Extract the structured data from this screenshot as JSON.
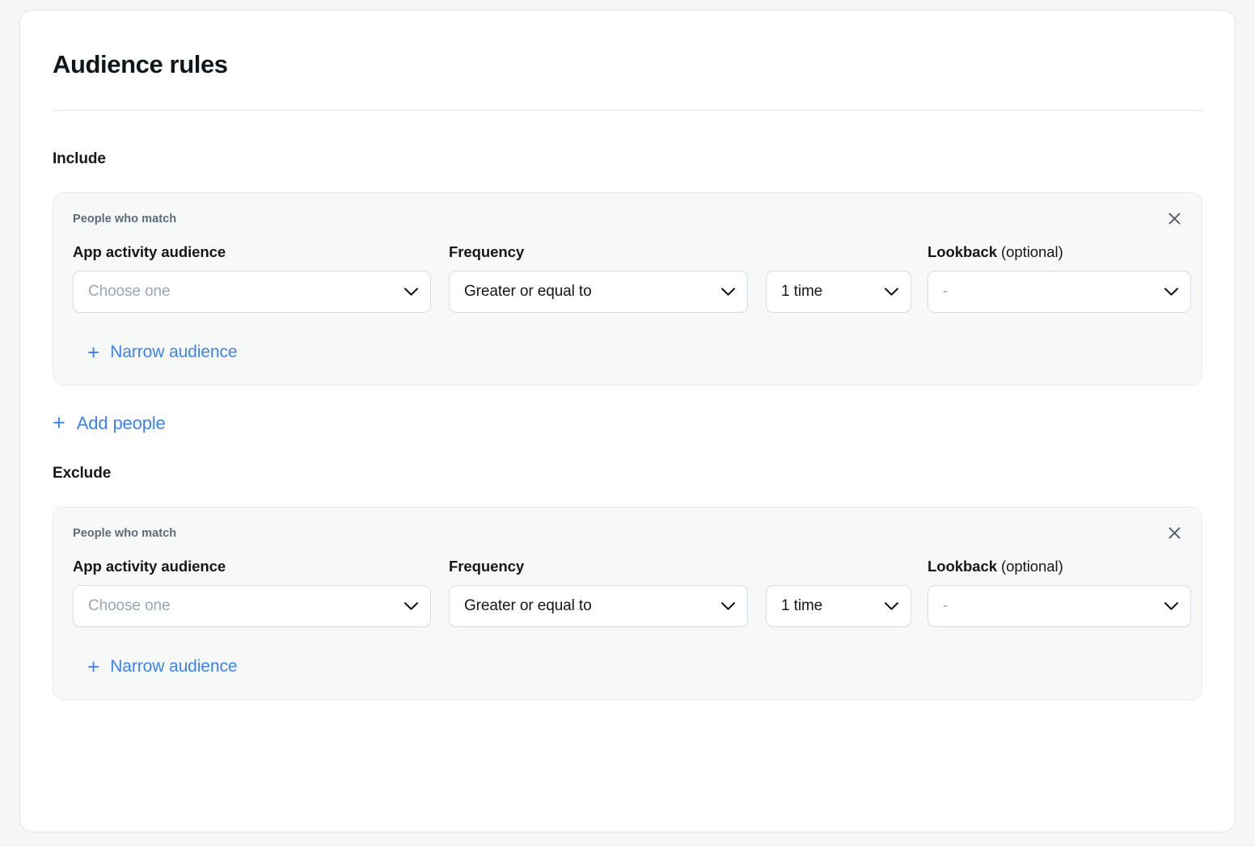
{
  "panel": {
    "title": "Audience rules"
  },
  "sections": [
    {
      "key": "include",
      "title": "Include",
      "card": {
        "eyebrow": "People who match",
        "close_icon": "close-icon",
        "fields": {
          "audience": {
            "label": "App activity audience",
            "value": "Choose one",
            "is_placeholder": true
          },
          "frequency": {
            "label": "Frequency",
            "value": "Greater or equal to",
            "is_placeholder": false
          },
          "count": {
            "label": "",
            "value": "1 time",
            "is_placeholder": false
          },
          "lookback": {
            "label": "Lookback",
            "label_optional": " (optional)",
            "value": "-",
            "is_placeholder": true
          }
        },
        "narrow_link": {
          "icon": "plus-icon",
          "label": "Narrow audience"
        }
      },
      "add_link": {
        "icon": "plus-icon",
        "label": "Add people"
      }
    },
    {
      "key": "exclude",
      "title": "Exclude",
      "card": {
        "eyebrow": "People who match",
        "close_icon": "close-icon",
        "fields": {
          "audience": {
            "label": "App activity audience",
            "value": "Choose one",
            "is_placeholder": true
          },
          "frequency": {
            "label": "Frequency",
            "value": "Greater or equal to",
            "is_placeholder": false
          },
          "count": {
            "label": "",
            "value": "1 time",
            "is_placeholder": false
          },
          "lookback": {
            "label": "Lookback",
            "label_optional": " (optional)",
            "value": "-",
            "is_placeholder": true
          }
        },
        "narrow_link": {
          "icon": "plus-icon",
          "label": "Narrow audience"
        }
      }
    }
  ],
  "colors": {
    "page_bg": "#f5f6f7",
    "panel_bg": "#ffffff",
    "card_bg": "#f7f8f8",
    "link_blue": "#3b82f6",
    "text_dark": "#14181b",
    "text_muted": "#5c6b7a",
    "placeholder": "#9aa6b2",
    "border": "#e3e6e8",
    "input_border": "#d6dce2"
  },
  "glyphs": {
    "plus": "+"
  }
}
